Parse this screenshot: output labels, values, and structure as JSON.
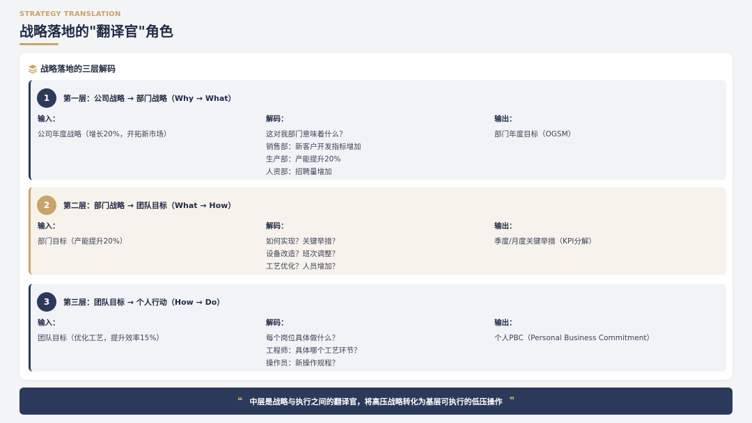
{
  "header": {
    "eyebrow": "STRATEGY TRANSLATION",
    "title": "战略落地的\"翻译官\"角色"
  },
  "panel": {
    "heading": "战略落地的三层解码",
    "icon": "layers-icon"
  },
  "colors": {
    "navy": "#2b3a5a",
    "gold": "#c9a36a",
    "background": "#f3f4f6"
  },
  "layers": [
    {
      "number": "1",
      "title": "第一层：公司战略 → 部门战略（Why → What）",
      "input_label": "输入：",
      "input_lines": [
        "公司年度战略（增长20%，开拓新市场）"
      ],
      "decode_label": "解码：",
      "decode_lines": [
        "这对我部门意味着什么？",
        "销售部：新客户开发指标增加",
        "生产部：产能提升20%",
        "人资部：招聘量增加"
      ],
      "output_label": "输出：",
      "output_lines": [
        "部门年度目标（OGSM）"
      ]
    },
    {
      "number": "2",
      "title": "第二层：部门战略 → 团队目标（What → How）",
      "input_label": "输入：",
      "input_lines": [
        "部门目标（产能提升20%）"
      ],
      "decode_label": "解码：",
      "decode_lines": [
        "如何实现？关键举措？",
        "设备改造？班次调整？",
        "工艺优化？人员增加？"
      ],
      "output_label": "输出：",
      "output_lines": [
        "季度/月度关键举措（KPI分解）"
      ]
    },
    {
      "number": "3",
      "title": "第三层：团队目标 → 个人行动（How → Do）",
      "input_label": "输入：",
      "input_lines": [
        "团队目标（优化工艺，提升效率15%）"
      ],
      "decode_label": "解码：",
      "decode_lines": [
        "每个岗位具体做什么？",
        "工程师：具体哪个工艺环节？",
        "操作员：新操作规程？"
      ],
      "output_label": "输出：",
      "output_lines": [
        "个人PBC（Personal Business Commitment）"
      ]
    }
  ],
  "footer": {
    "open_quote": "❝",
    "text": "中层是战略与执行之间的翻译官，将高压战略转化为基层可执行的低压操作",
    "close_quote": "❞"
  }
}
